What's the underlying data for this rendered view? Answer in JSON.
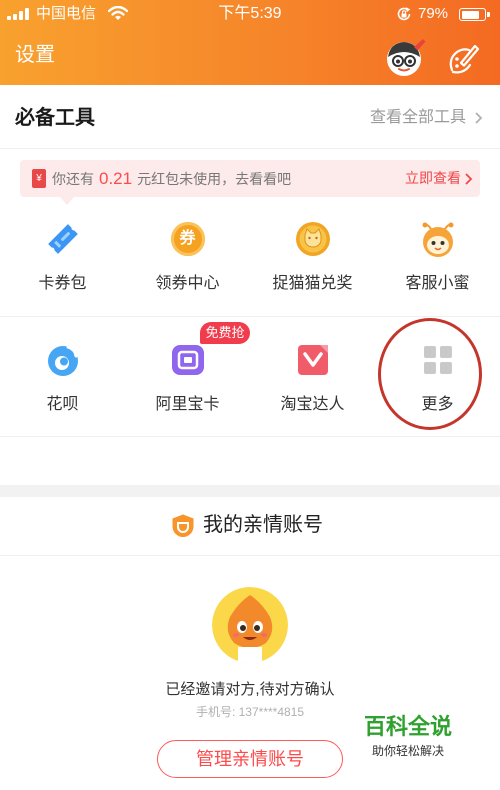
{
  "status_bar": {
    "carrier": "中国电信",
    "time": "下午5:39",
    "battery": "79%"
  },
  "header": {
    "title": "设置"
  },
  "tools": {
    "title": "必备工具",
    "view_all": "查看全部工具",
    "row1": [
      {
        "label": "卡券包",
        "icon": "ticket-icon"
      },
      {
        "label": "领券中心",
        "icon": "coupon-coin-icon",
        "icon_text": "券"
      },
      {
        "label": "捉猫猫兑奖",
        "icon": "cat-coin-icon"
      },
      {
        "label": "客服小蜜",
        "icon": "bee-assistant-icon"
      }
    ],
    "row2": [
      {
        "label": "花呗",
        "icon": "huabei-icon"
      },
      {
        "label": "阿里宝卡",
        "icon": "sim-card-icon",
        "badge": "免费抢"
      },
      {
        "label": "淘宝达人",
        "icon": "v-talent-icon"
      },
      {
        "label": "更多",
        "icon": "grid-more-icon"
      }
    ]
  },
  "banner": {
    "icon_text": "¥",
    "prefix": "你还有",
    "amount": "0.21",
    "suffix": "元红包未使用，去看看吧",
    "action": "立即查看"
  },
  "family": {
    "title": "我的亲情账号",
    "status": "已经邀请对方,待对方确认",
    "phone": "手机号: 137****4815",
    "button": "管理亲情账号"
  },
  "watermark": {
    "title": "百科全说",
    "subtitle": "助你轻松解决"
  },
  "colors": {
    "header_start": "#f8a12e",
    "header_end": "#f46a22",
    "accent_red": "#ff4b4b",
    "highlight_circle": "#c4352b",
    "watermark_green": "#2ea12e"
  }
}
